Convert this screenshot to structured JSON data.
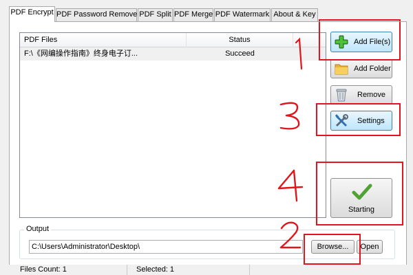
{
  "tabs": [
    {
      "label": "PDF Encrypt",
      "active": true
    },
    {
      "label": "PDF Password Remover",
      "active": false
    },
    {
      "label": "PDF Split",
      "active": false
    },
    {
      "label": "PDF Merge",
      "active": false
    },
    {
      "label": "PDF Watermark",
      "active": false
    },
    {
      "label": "About & Key",
      "active": false
    }
  ],
  "file_list": {
    "columns": [
      "PDF Files",
      "Status"
    ],
    "rows": [
      {
        "file": "F:\\《网编操作指南》终身电子订...",
        "status": "Succeed"
      }
    ]
  },
  "buttons": {
    "add_files": {
      "label": "Add File(s)",
      "icon": "green-plus-icon"
    },
    "add_folder": {
      "label": "Add Folder",
      "icon": "folder-icon"
    },
    "remove": {
      "label": "Remove",
      "icon": "recycle-bin-icon"
    },
    "settings": {
      "label": "Settings",
      "icon": "tools-icon"
    },
    "starting": {
      "label": "Starting",
      "icon": "checkmark-icon"
    },
    "browse": {
      "label": "Browse..."
    },
    "open": {
      "label": "Open"
    }
  },
  "output": {
    "title": "Output",
    "path": "C:\\Users\\Administrator\\Desktop\\"
  },
  "status_bar": {
    "files_count": "Files Count: 1",
    "selected": "Selected: 1"
  },
  "annotations": [
    {
      "number": "1",
      "target": "add_files",
      "color": "#e0141b"
    },
    {
      "number": "2",
      "target": "browse",
      "color": "#e0141b"
    },
    {
      "number": "3",
      "target": "settings",
      "color": "#e0141b"
    },
    {
      "number": "4",
      "target": "starting",
      "color": "#e0141b"
    }
  ],
  "colors": {
    "annotation_red": "#e0141b",
    "panel_bg": "#ffffff",
    "window_bg": "#f0f0f0",
    "focus_border": "#3c7fb1"
  }
}
